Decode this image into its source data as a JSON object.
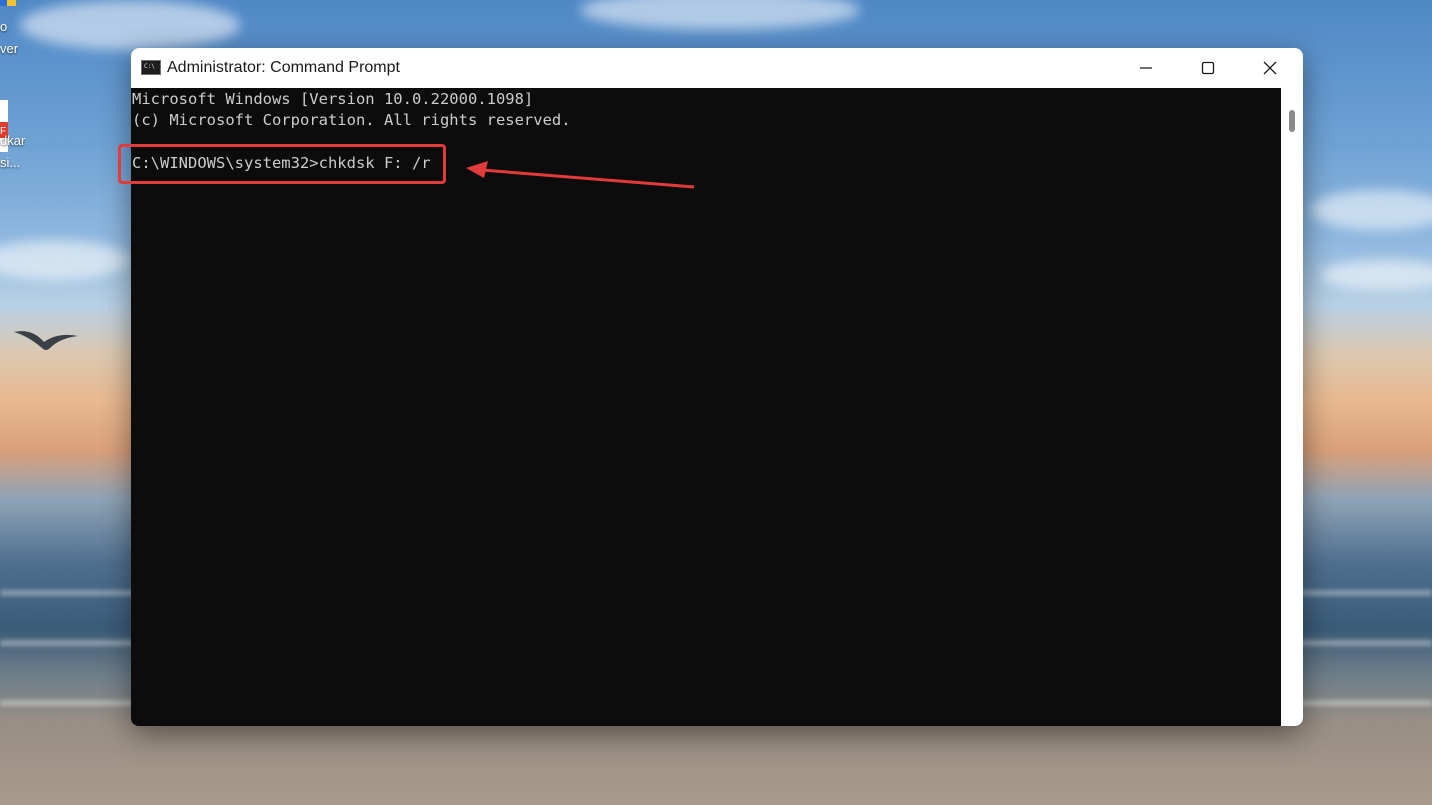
{
  "desktop": {
    "icons": [
      {
        "label_lines": [
          "o",
          "ver"
        ],
        "icon": "shield-app-icon"
      },
      {
        "label_lines": [
          "dkar",
          "si..."
        ],
        "icon": "pdf-file-icon"
      }
    ]
  },
  "window": {
    "title": "Administrator: Command Prompt",
    "icon": "cmd-icon",
    "controls": {
      "minimize": "minimize-icon",
      "maximize": "maximize-icon",
      "close": "close-icon"
    }
  },
  "console": {
    "lines": [
      "Microsoft Windows [Version 10.0.22000.1098]",
      "(c) Microsoft Corporation. All rights reserved.",
      "",
      "C:\\WINDOWS\\system32>chkdsk F: /r"
    ]
  },
  "annotation": {
    "color": "#e23b3b"
  }
}
